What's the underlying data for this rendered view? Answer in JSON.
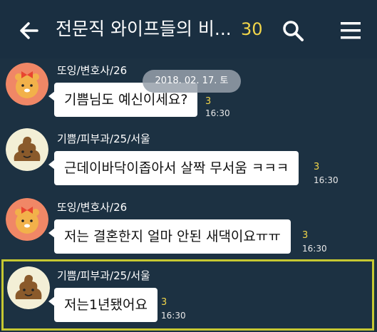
{
  "header": {
    "title": "전문직 와이프들의 비...",
    "member_count": "30"
  },
  "date_chip": "2018. 02. 17. 토",
  "messages": [
    {
      "sender": "또잉/변호사/26",
      "text": "기쁨님도 예신이세요?",
      "unread": "3",
      "time": "16:30",
      "avatar": "ryan-avatar"
    },
    {
      "sender": "기쁨/피부과/25/서울",
      "text": "근데이바닥이좁아서 살짝 무서움 ㅋㅋㅋ",
      "unread": "3",
      "time": "16:30",
      "avatar": "poop-avatar"
    },
    {
      "sender": "또잉/변호사/26",
      "text": "저는 결혼한지 얼마 안된 새댁이요ㅠㅠ",
      "unread": "3",
      "time": "16:30",
      "avatar": "ryan-avatar"
    },
    {
      "sender": "기쁨/피부과/25/서울",
      "text": "저는1년됐어요",
      "unread": "3",
      "time": "16:30",
      "avatar": "poop-avatar"
    }
  ],
  "colors": {
    "background": "#1c3142",
    "accent": "#f1d54a",
    "highlight": "#c6c832"
  }
}
